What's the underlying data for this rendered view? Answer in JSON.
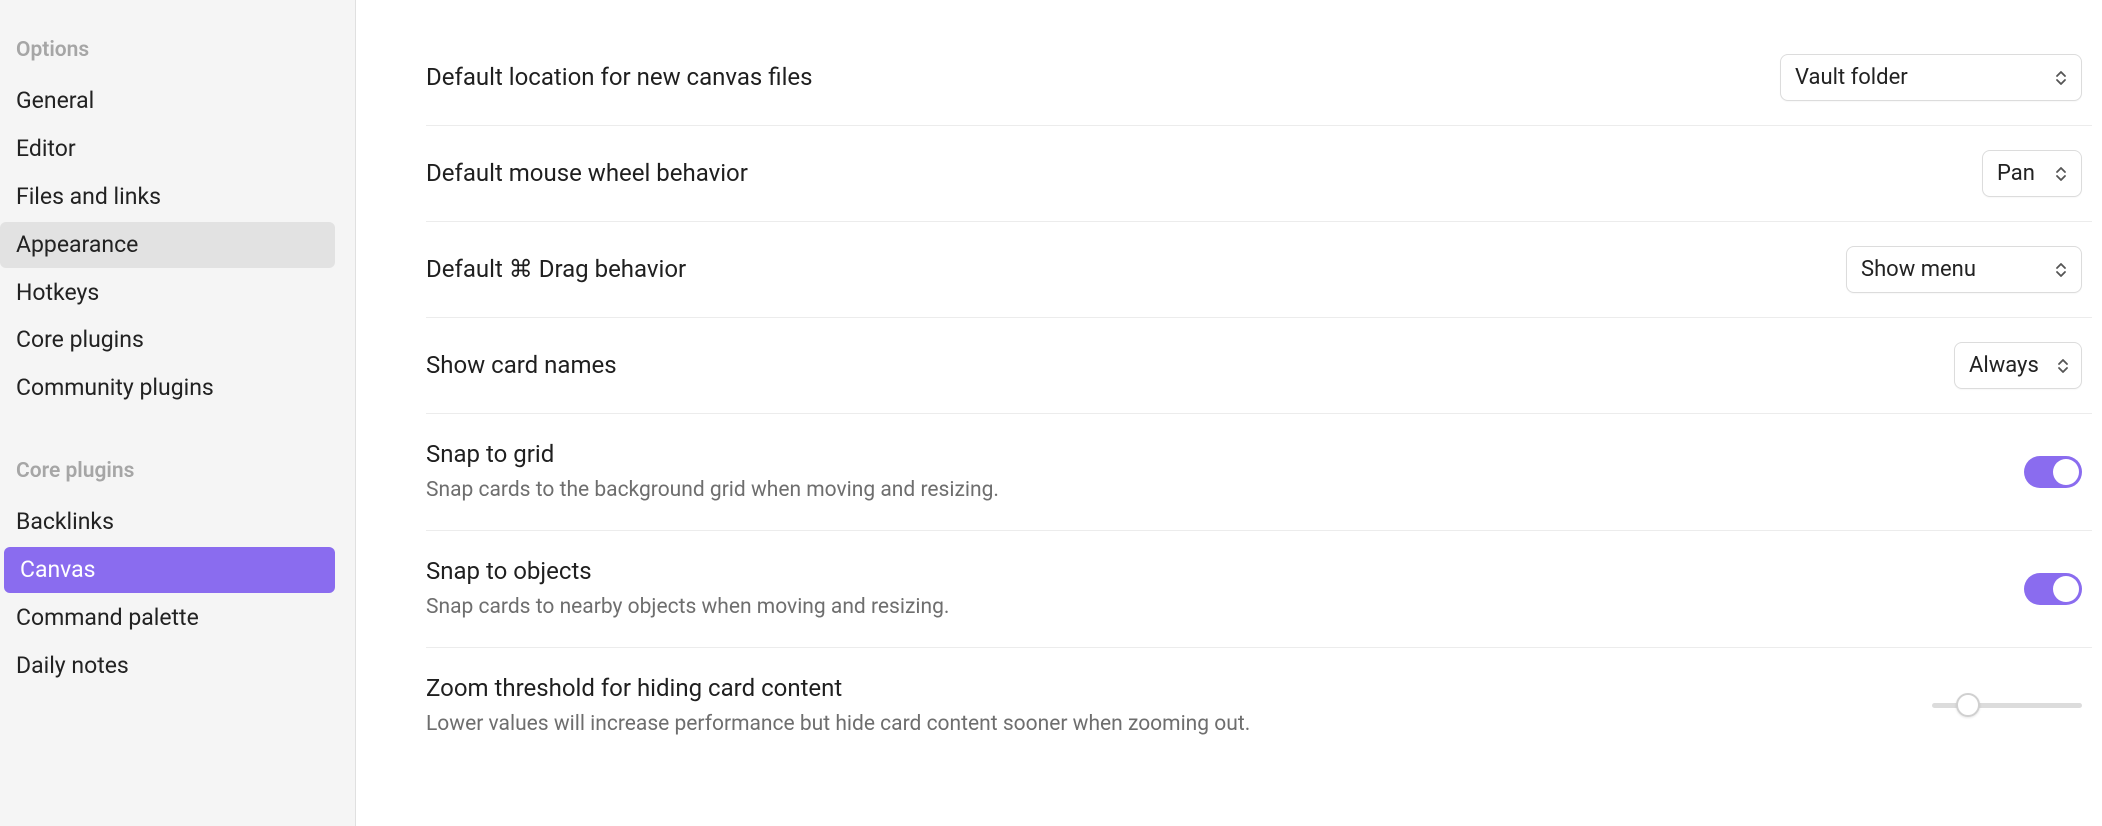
{
  "sidebar": {
    "sections": [
      {
        "header": "Options",
        "items": [
          {
            "key": "general",
            "label": "General",
            "state": ""
          },
          {
            "key": "editor",
            "label": "Editor",
            "state": ""
          },
          {
            "key": "files",
            "label": "Files and links",
            "state": ""
          },
          {
            "key": "appearance",
            "label": "Appearance",
            "state": "hover"
          },
          {
            "key": "hotkeys",
            "label": "Hotkeys",
            "state": ""
          },
          {
            "key": "core",
            "label": "Core plugins",
            "state": ""
          },
          {
            "key": "community",
            "label": "Community plugins",
            "state": ""
          }
        ]
      },
      {
        "header": "Core plugins",
        "items": [
          {
            "key": "backlinks",
            "label": "Backlinks",
            "state": ""
          },
          {
            "key": "canvas",
            "label": "Canvas",
            "state": "active"
          },
          {
            "key": "cmd",
            "label": "Command palette",
            "state": ""
          },
          {
            "key": "daily",
            "label": "Daily notes",
            "state": ""
          }
        ]
      }
    ]
  },
  "settings": {
    "canvas_location": {
      "title": "Default location for new canvas files",
      "value": "Vault folder"
    },
    "wheel": {
      "title": "Default mouse wheel behavior",
      "value": "Pan"
    },
    "drag": {
      "title": "Default ⌘ Drag behavior",
      "value": "Show menu"
    },
    "card_names": {
      "title": "Show card names",
      "value": "Always"
    },
    "snap_grid": {
      "title": "Snap to grid",
      "desc": "Snap cards to the background grid when moving and resizing.",
      "enabled": true
    },
    "snap_objects": {
      "title": "Snap to objects",
      "desc": "Snap cards to nearby objects when moving and resizing.",
      "enabled": true
    },
    "zoom_threshold": {
      "title": "Zoom threshold for hiding card content",
      "desc": "Lower values will increase performance but hide card content sooner when zooming out."
    }
  },
  "colors": {
    "accent": "#8a6cef"
  }
}
